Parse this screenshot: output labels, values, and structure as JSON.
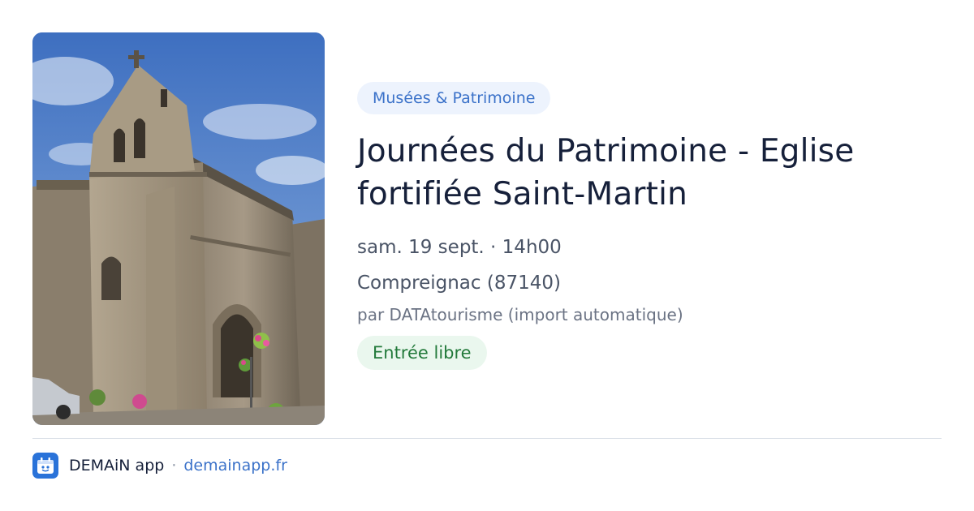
{
  "event": {
    "category": "Musées & Patrimoine",
    "title": "Journées du Patrimoine - Eglise fortifiée Saint-Martin",
    "datetime": "sam. 19 sept. · 14h00",
    "location": "Compreignac (87140)",
    "source": "par DATAtourisme (import automatique)",
    "price": "Entrée libre",
    "photo_icon": "church-photo"
  },
  "footer": {
    "app_name": "DEMAiN app",
    "separator": "·",
    "url": "demainapp.fr",
    "icon": "demain-app-icon"
  },
  "colors": {
    "accent": "#3b72c9",
    "category_bg": "#edf3fd",
    "price_bg": "#eaf7ee",
    "price_text": "#237a3b",
    "title": "#16203a"
  }
}
